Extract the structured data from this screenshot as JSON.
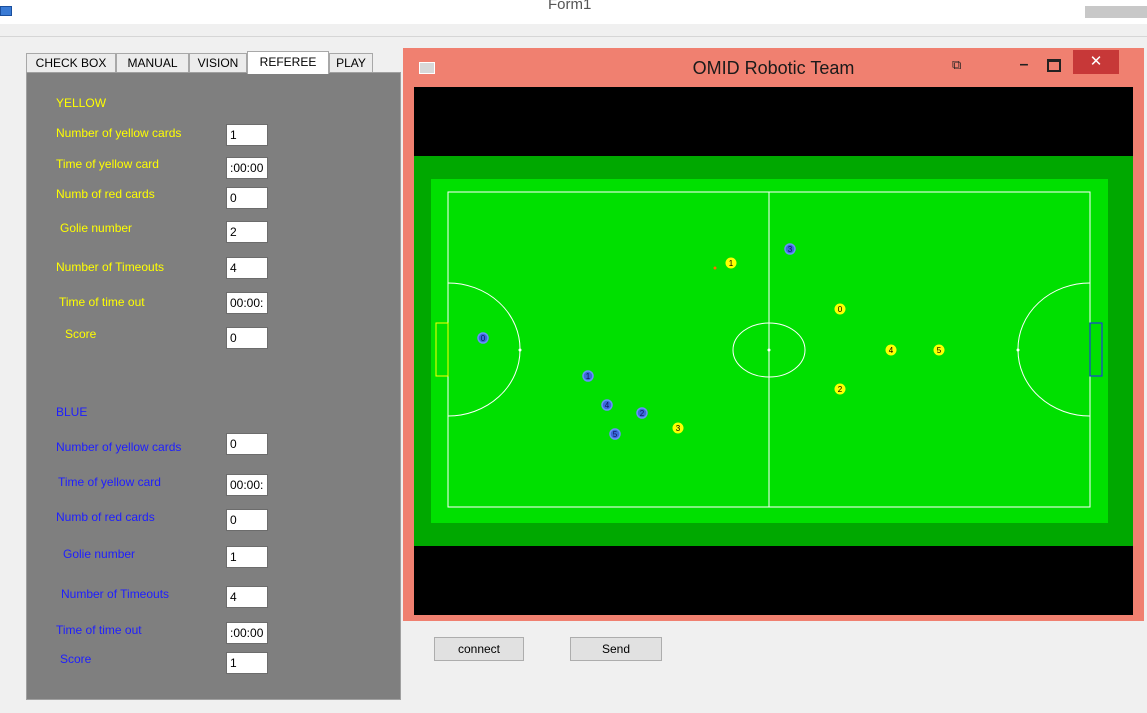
{
  "window": {
    "title": "Form1"
  },
  "tabs": [
    "CHECK BOX",
    "MANUAL",
    "VISION",
    "REFEREE",
    "PLAY"
  ],
  "active_tab": "REFEREE",
  "yellow": {
    "heading": "YELLOW",
    "color": "#ffff00",
    "fields": [
      {
        "label": "Number of yellow cards",
        "value": "1"
      },
      {
        "label": "Time of yellow card",
        "value": ":00:00"
      },
      {
        "label": "Numb of red cards",
        "value": "0"
      },
      {
        "label": "Golie number",
        "value": "2"
      },
      {
        "label": "Number of Timeouts",
        "value": "4"
      },
      {
        "label": "Time of time out",
        "value": "00:00:"
      },
      {
        "label": "Score",
        "value": "0"
      }
    ]
  },
  "blue": {
    "heading": "BLUE",
    "color": "#1e1eff",
    "fields": [
      {
        "label": "Number of yellow cards",
        "value": "0"
      },
      {
        "label": "Time of yellow card",
        "value": "00:00:"
      },
      {
        "label": "Numb of red cards",
        "value": "0"
      },
      {
        "label": "Golie number",
        "value": "1"
      },
      {
        "label": "Number of Timeouts",
        "value": "4"
      },
      {
        "label": "Time of time out",
        "value": ":00:00"
      },
      {
        "label": "Score",
        "value": "1"
      }
    ]
  },
  "viewer": {
    "title": "OMID  Robotic Team",
    "close_glyph": "✕",
    "min_glyph": "–",
    "snap_glyph": "⧉"
  },
  "field_colors": {
    "outer": "#00a800",
    "inner": "#00e000",
    "lines": "#ffffff",
    "background": "#000000"
  },
  "robots": {
    "blue": [
      "0",
      "3",
      "1",
      "4",
      "2",
      "5"
    ],
    "yellow": [
      "1",
      "0",
      "4",
      "5",
      "2",
      "3"
    ]
  },
  "buttons": {
    "connect": "connect",
    "send": "Send"
  }
}
